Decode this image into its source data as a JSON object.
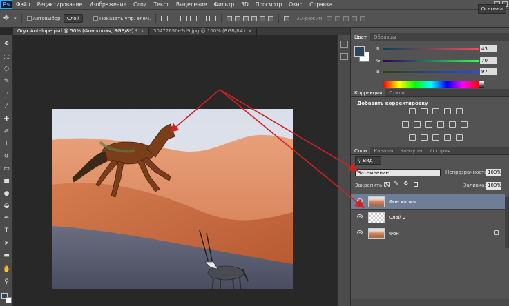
{
  "app": {
    "logo": "Ps"
  },
  "menu": [
    "Файл",
    "Редактирование",
    "Изображение",
    "Слои",
    "Текст",
    "Выделение",
    "Фильтр",
    "3D",
    "Просмотр",
    "Окно",
    "Справка"
  ],
  "options": {
    "autoselect_label": "Автовыбор:",
    "autoselect_value": "Слой",
    "show_controls_label": "Показать упр. элем.",
    "mode_3d_label": "3D-режим:",
    "workspace": "Основна"
  },
  "tabs": [
    {
      "label": "Oryx Antelope.psd @ 50% (Фон копия, RGB/8*) *"
    },
    {
      "label": "30472690e2d9.jpg @ 100% (RGB/8#)"
    }
  ],
  "color_panel": {
    "tabs": [
      "Цвет",
      "Образцы"
    ],
    "channels": [
      {
        "label": "R",
        "value": "43"
      },
      {
        "label": "G",
        "value": "70"
      },
      {
        "label": "B",
        "value": "97"
      }
    ],
    "colors": {
      "foreground": "#2b465a",
      "background": "#ffffff"
    }
  },
  "adjustments_panel": {
    "tabs": [
      "Коррекция",
      "Стили"
    ],
    "title": "Добавить корректировку"
  },
  "layers_panel": {
    "tabs": [
      "Слои",
      "Каналы",
      "Контуры",
      "История"
    ],
    "kind": "Вид",
    "blend_mode": "Затемнение",
    "opacity_label": "Непрозрачность:",
    "opacity_value": "100%",
    "lock_label": "Закрепить:",
    "fill_label": "Заливка:",
    "fill_value": "100%",
    "layers": [
      {
        "name": "Фон копия",
        "selected": true
      },
      {
        "name": "Слой 2",
        "selected": false
      },
      {
        "name": "Фон",
        "selected": false,
        "locked": true
      }
    ]
  },
  "accent": {
    "arrow": "#d42020",
    "selection": "#6d7e96"
  }
}
